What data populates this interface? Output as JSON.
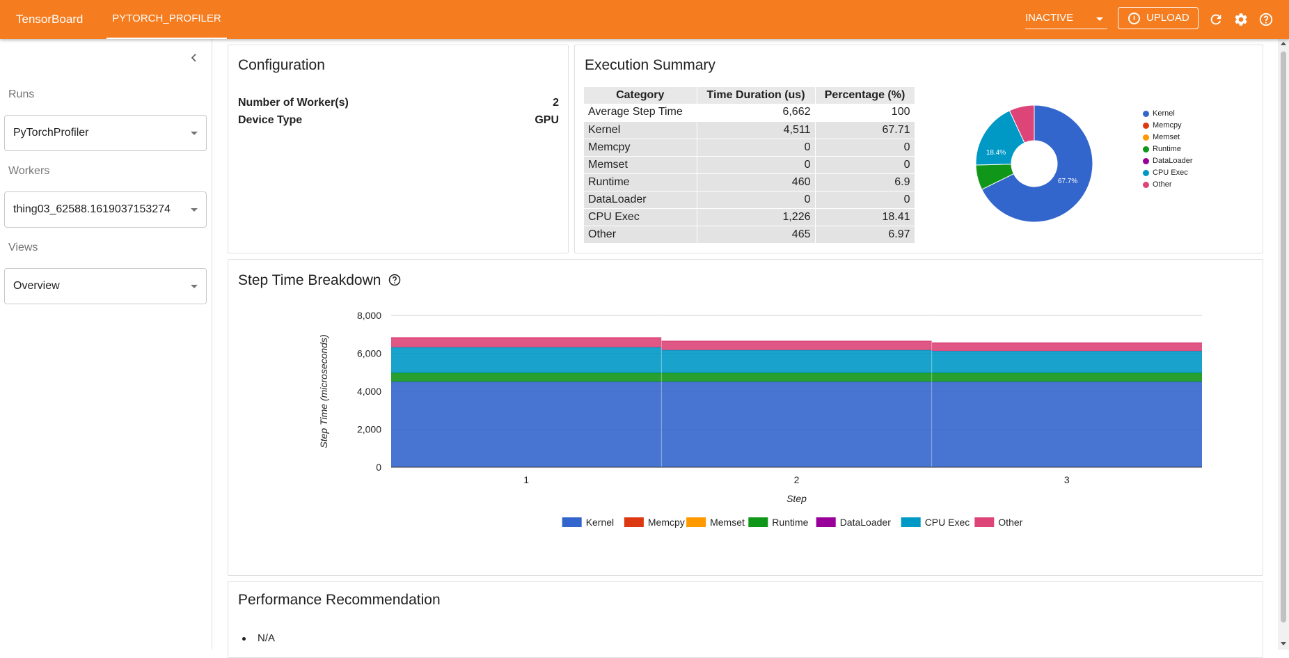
{
  "topbar": {
    "brand": "TensorBoard",
    "plugin_tab": "PYTORCH_PROFILER",
    "plugin_select": "INACTIVE",
    "upload_label": "UPLOAD",
    "icons": [
      "refresh-icon",
      "gear-icon",
      "help-icon"
    ],
    "color": "#f57c1f"
  },
  "sidebar": {
    "runs_label": "Runs",
    "runs_value": "PyTorchProfiler",
    "workers_label": "Workers",
    "workers_value": "thing03_62588.1619037153274",
    "views_label": "Views",
    "views_value": "Overview"
  },
  "configuration": {
    "title": "Configuration",
    "rows": [
      {
        "label": "Number of Worker(s)",
        "value": "2"
      },
      {
        "label": "Device Type",
        "value": "GPU"
      }
    ]
  },
  "execution_summary": {
    "title": "Execution Summary",
    "columns": [
      "Category",
      "Time Duration (us)",
      "Percentage (%)"
    ],
    "rows": [
      [
        "Average Step Time",
        "6,662",
        "100"
      ],
      [
        "Kernel",
        "4,511",
        "67.71"
      ],
      [
        "Memcpy",
        "0",
        "0"
      ],
      [
        "Memset",
        "0",
        "0"
      ],
      [
        "Runtime",
        "460",
        "6.9"
      ],
      [
        "DataLoader",
        "0",
        "0"
      ],
      [
        "CPU Exec",
        "1,226",
        "18.41"
      ],
      [
        "Other",
        "465",
        "6.97"
      ]
    ],
    "pie_labels": [
      "67.7%",
      "18.4%"
    ]
  },
  "step_breakdown": {
    "title": "Step Time Breakdown",
    "help_icon": "help-circle-icon"
  },
  "recommendation": {
    "title": "Performance Recommendation",
    "items": [
      "N/A"
    ]
  },
  "chart_data": [
    {
      "type": "pie",
      "title": "",
      "donut": true,
      "categories": [
        "Kernel",
        "Memcpy",
        "Memset",
        "Runtime",
        "DataLoader",
        "CPU Exec",
        "Other"
      ],
      "values": [
        67.71,
        0,
        0,
        6.9,
        0,
        18.41,
        6.97
      ],
      "colors": [
        "#3366cc",
        "#dc3912",
        "#ff9900",
        "#109618",
        "#990099",
        "#0099c6",
        "#dd4477"
      ],
      "legend_position": "right"
    },
    {
      "type": "area",
      "stacked": true,
      "title": "",
      "xlabel": "Step",
      "ylabel": "Step Time (microseconds)",
      "categories": [
        "1",
        "2",
        "3"
      ],
      "ylim": [
        0,
        8000
      ],
      "yticks": [
        "0",
        "2,000",
        "4,000",
        "6,000",
        "8,000"
      ],
      "series": [
        {
          "name": "Kernel",
          "values": [
            4511,
            4511,
            4511
          ],
          "color": "#3366cc"
        },
        {
          "name": "Memcpy",
          "values": [
            0,
            0,
            0
          ],
          "color": "#dc3912"
        },
        {
          "name": "Memset",
          "values": [
            0,
            0,
            0
          ],
          "color": "#ff9900"
        },
        {
          "name": "Runtime",
          "values": [
            460,
            460,
            460
          ],
          "color": "#109618"
        },
        {
          "name": "DataLoader",
          "values": [
            0,
            0,
            0
          ],
          "color": "#990099"
        },
        {
          "name": "CPU Exec",
          "values": [
            1350,
            1200,
            1150
          ],
          "color": "#0099c6"
        },
        {
          "name": "Other",
          "values": [
            500,
            465,
            430
          ],
          "color": "#dd4477"
        }
      ],
      "legend_position": "bottom"
    }
  ]
}
